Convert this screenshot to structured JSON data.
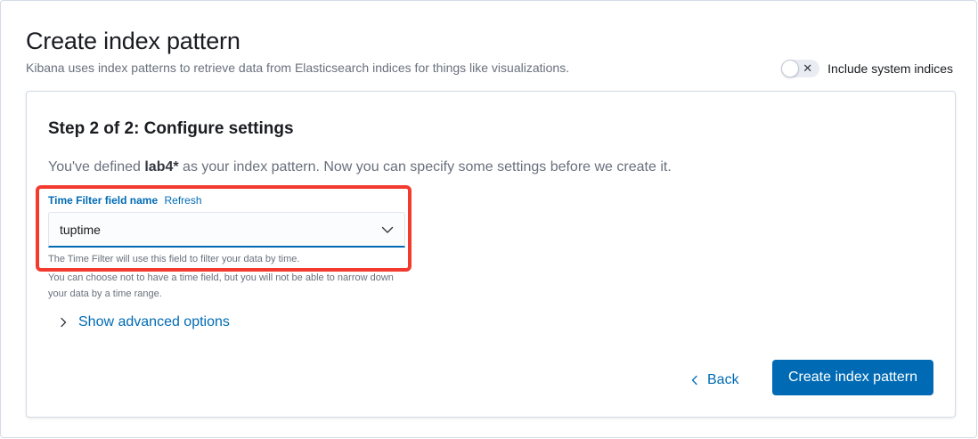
{
  "header": {
    "title": "Create index pattern",
    "subtitle": "Kibana uses index patterns to retrieve data from Elasticsearch indices for things like visualizations.",
    "system_toggle": {
      "label": "Include system indices",
      "checked": false,
      "icon": "x-icon"
    }
  },
  "step": {
    "title": "Step 2 of 2: Configure settings",
    "desc_prefix": "You've defined ",
    "pattern": "lab4*",
    "desc_suffix": " as your index pattern. Now you can specify some settings before we create it."
  },
  "time_filter": {
    "label": "Time Filter field name",
    "refresh": "Refresh",
    "value": "tuptime",
    "help_primary": "The Time Filter will use this field to filter your data by time.",
    "help_secondary": "You can choose not to have a time field, but you will not be able to narrow down your data by a time range."
  },
  "advanced": {
    "label": "Show advanced options",
    "icon": "chevron-right-icon"
  },
  "actions": {
    "back_label": "Back",
    "back_icon": "chevron-left-icon",
    "create_label": "Create index pattern"
  },
  "colors": {
    "accent": "#006bb4",
    "highlight": "#f23a2f"
  }
}
